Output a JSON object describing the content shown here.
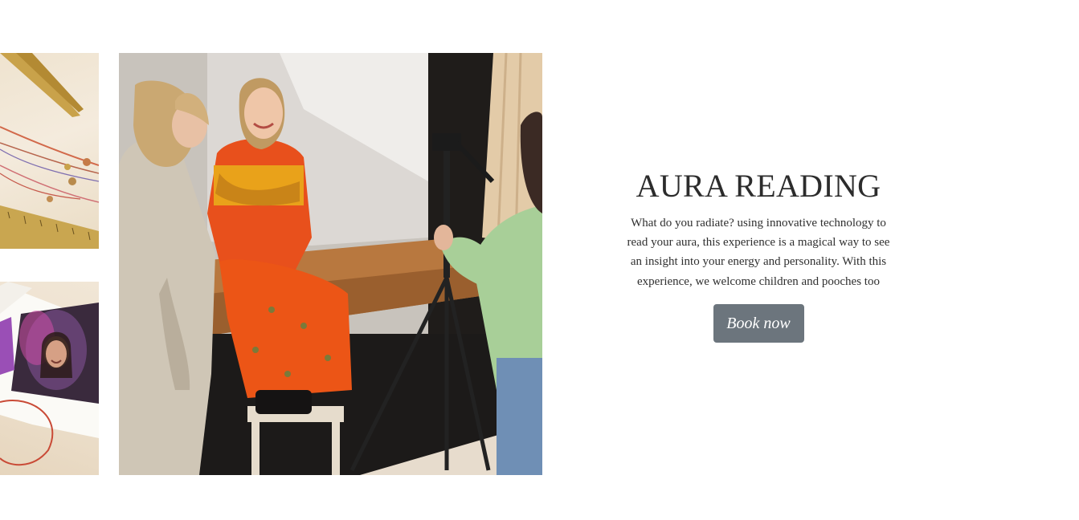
{
  "images": {
    "jewelry": "jewelry-bracelets-photo",
    "polaroid": "polaroid-aura-photo",
    "main": "aura-reading-session-photo"
  },
  "feature": {
    "title": "AURA READING",
    "description": "What do you radiate? using innovative technology to read your aura, this experience is a magical way to see an insight into your energy and personality. With this experience, we welcome children and pooches too",
    "button_label": "Book now"
  },
  "colors": {
    "button_bg": "#6c757d",
    "button_text": "#ffffff",
    "text": "#2b2b2b",
    "page_bg": "#ffffff"
  }
}
